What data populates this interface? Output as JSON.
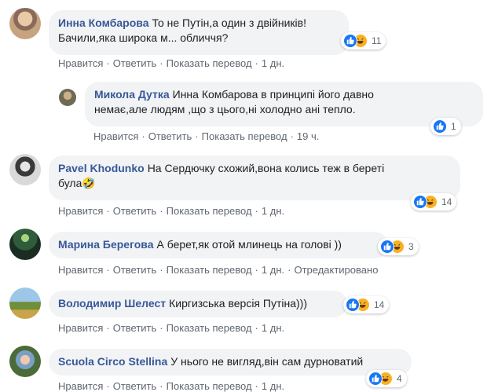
{
  "actions": {
    "like": "Нравится",
    "reply": "Ответить",
    "translate": "Показать перевод",
    "edited": "Отредактировано"
  },
  "comments": [
    {
      "author": "Инна Комбарова",
      "line1": "То не Путін,а один з двійників!",
      "line2": "Бачили,яка широка м... обличчя?",
      "reactions": "11",
      "time": "1 дн.",
      "types": [
        "like-icon",
        "haha-icon"
      ]
    },
    {
      "author": "Микола Дутка",
      "line1": "Инна Комбарова в принципі його давно",
      "line2": "немає,але людям ,що з цього,ні холодно ані тепло.",
      "reactions": "1",
      "time": "19 ч.",
      "types": [
        "like-icon"
      ]
    },
    {
      "author": "Pavel Khodunko",
      "line1": "На Сердючку схожий,вона колись теж в береті",
      "line2": "була🤣",
      "reactions": "14",
      "time": "1 дн.",
      "types": [
        "like-icon",
        "haha-icon"
      ]
    },
    {
      "author": "Марина Берегова",
      "line1": "А берет,як отой млинець на голові ))",
      "reactions": "3",
      "time": "1 дн.",
      "types": [
        "like-icon",
        "haha-icon"
      ]
    },
    {
      "author": "Володимир Шелест",
      "line1": "Киргизська версія Путіна)))",
      "reactions": "14",
      "time": "1 дн.",
      "types": [
        "like-icon",
        "haha-icon"
      ]
    },
    {
      "author": "Scuola Circo Stellina",
      "line1": "У нього не вигляд,він сам дурноватий",
      "reactions": "4",
      "time": "1 дн.",
      "types": [
        "like-icon",
        "haha-icon"
      ]
    }
  ],
  "colors": {
    "author": "#385898",
    "bubble": "#f2f3f5",
    "like": "#1877f2",
    "haha": "#f7b125"
  }
}
